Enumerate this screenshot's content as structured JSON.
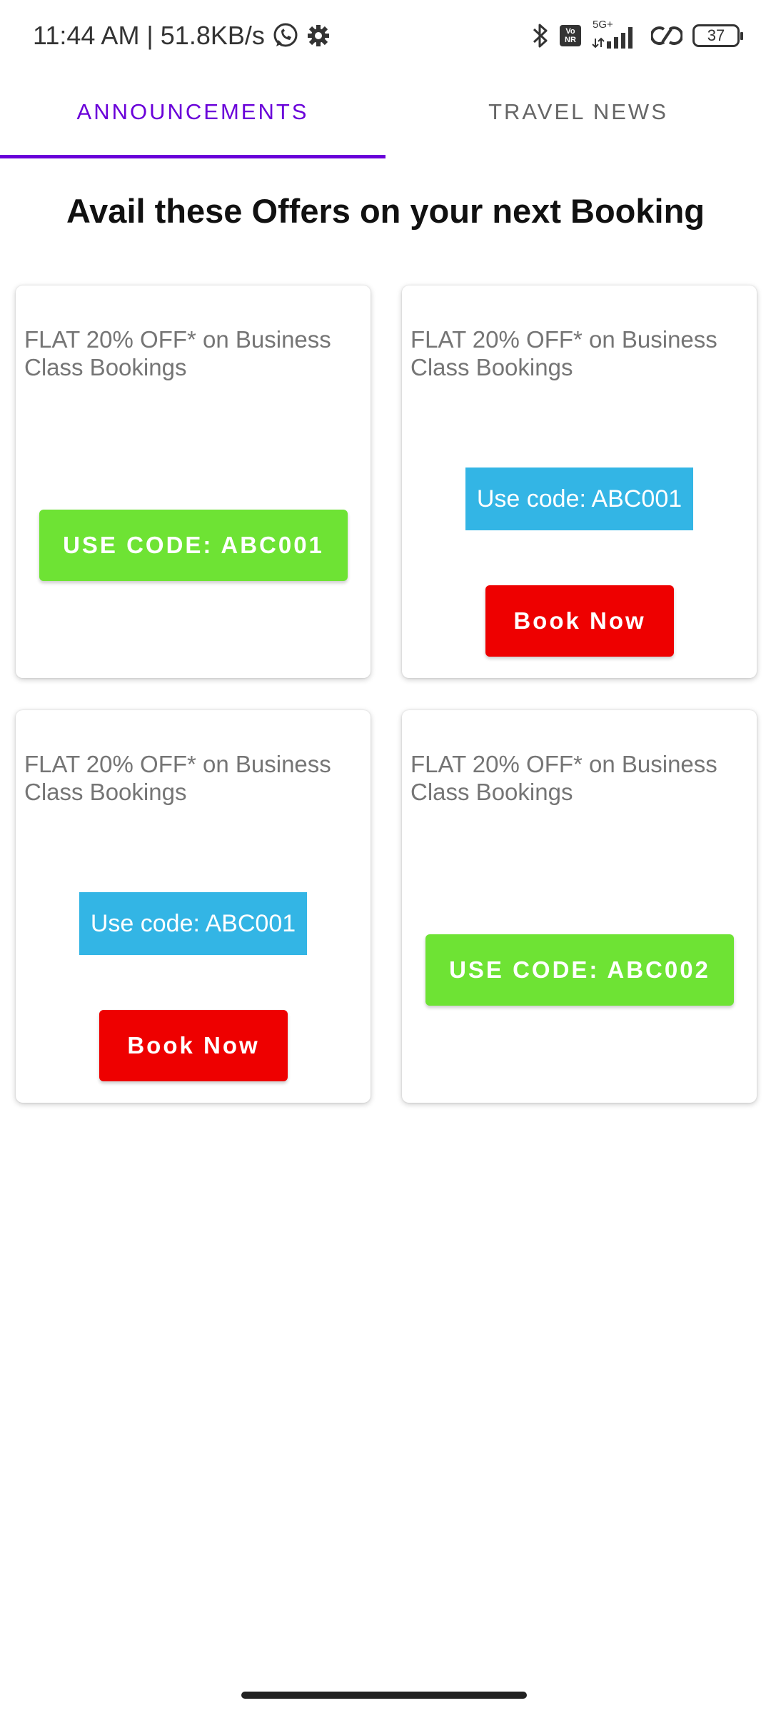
{
  "status_bar": {
    "time_speed": "11:44 AM | 51.8KB/s",
    "network_label": "5G+",
    "volte_label": "Vo\nNR",
    "battery": "37",
    "icons": [
      "whatsapp-icon",
      "settings-icon",
      "bluetooth-icon",
      "volte-icon",
      "signal-icon",
      "link-icon",
      "battery-icon"
    ]
  },
  "tabs": [
    {
      "label": "ANNOUNCEMENTS",
      "active": true
    },
    {
      "label": "TRAVEL NEWS",
      "active": false
    }
  ],
  "page_title": "Avail these Offers on your next Booking",
  "offers": [
    {
      "text": "FLAT 20% OFF* on Business Class Bookings",
      "code_button": "USE CODE: ABC001"
    },
    {
      "text": "FLAT 20% OFF* on Business Class Bookings",
      "code_label": "Use code: ABC001",
      "book_button": "Book Now"
    },
    {
      "text": "FLAT 20% OFF* on Business Class Bookings",
      "code_label": "Use code: ABC001",
      "book_button": "Book Now"
    },
    {
      "text": "FLAT 20% OFF* on Business Class Bookings",
      "code_button": "USE CODE: ABC002"
    }
  ],
  "colors": {
    "accent": "#6a00d9",
    "green_button": "#6ee334",
    "code_blue": "#33b5e5",
    "book_red": "#ee0000"
  }
}
